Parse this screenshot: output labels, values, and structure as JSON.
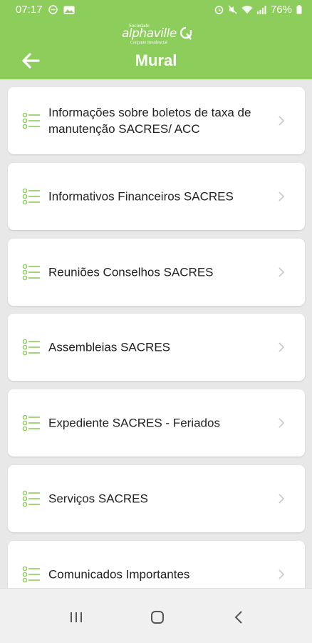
{
  "status_bar": {
    "time": "07:17",
    "battery": "76%"
  },
  "logo": {
    "top_text": "Sociedade",
    "brand": "alphaville",
    "bottom_text": "Conjunto Residencial"
  },
  "header": {
    "title": "Mural",
    "back_icon": "arrow-left-icon"
  },
  "colors": {
    "header_bg": "#8ccd5c",
    "accent": "#8ccd5c"
  },
  "items": [
    {
      "label": "Informações sobre boletos de taxa de manutenção SACRES/ ACC"
    },
    {
      "label": "Informativos Financeiros SACRES"
    },
    {
      "label": "Reuniões Conselhos SACRES"
    },
    {
      "label": "Assembleias SACRES"
    },
    {
      "label": "Expediente SACRES - Feriados"
    },
    {
      "label": "Serviços SACRES"
    },
    {
      "label": "Comunicados Importantes"
    }
  ],
  "nav": {
    "recents_icon": "recents-icon",
    "home_icon": "home-icon",
    "back_icon": "back-icon"
  }
}
